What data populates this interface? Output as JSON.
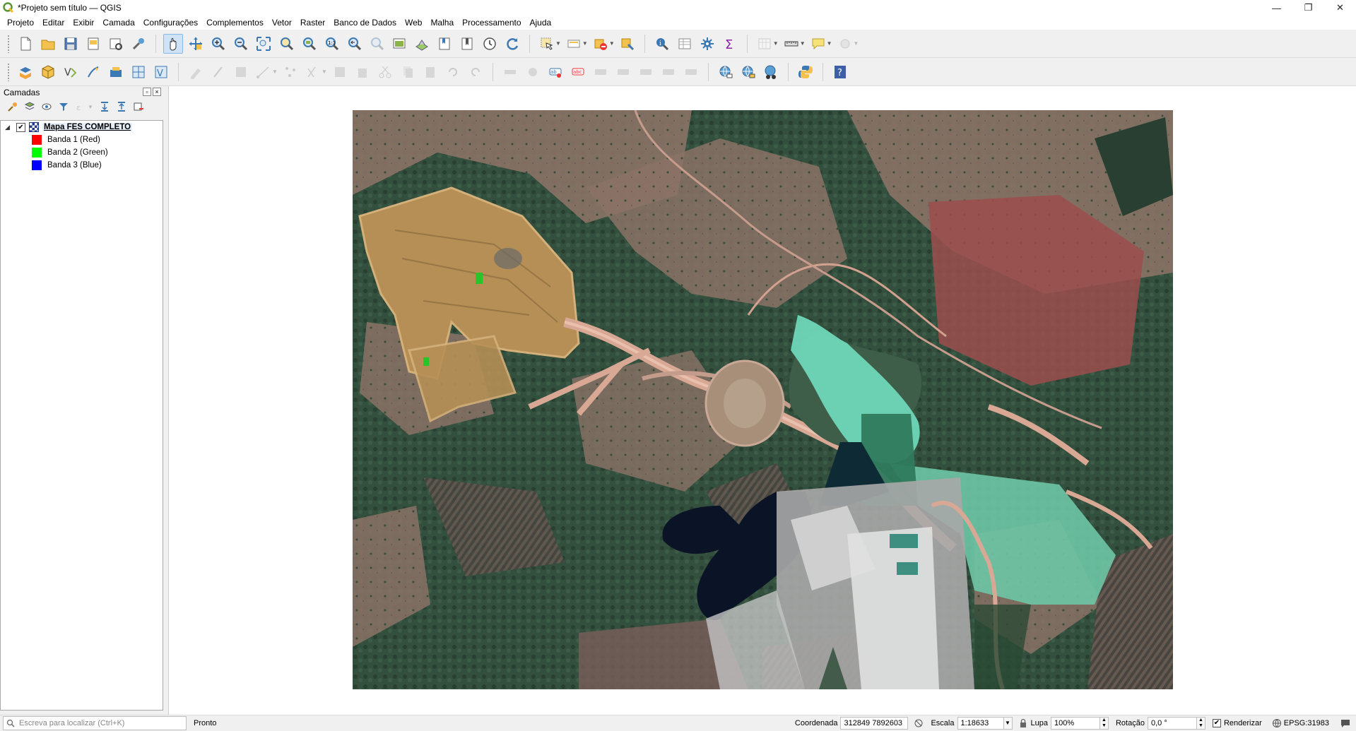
{
  "window": {
    "title": "*Projeto sem título — QGIS",
    "controls": {
      "minimize": "—",
      "maximize": "❐",
      "close": "✕"
    }
  },
  "menu": [
    "Projeto",
    "Editar",
    "Exibir",
    "Camada",
    "Configurações",
    "Complementos",
    "Vetor",
    "Raster",
    "Banco de Dados",
    "Web",
    "Malha",
    "Processamento",
    "Ajuda"
  ],
  "toolbars": {
    "primary_icons": [
      "new-project-icon",
      "open-project-icon",
      "save-project-icon",
      "new-print-layout-icon",
      "layout-manager-icon",
      "style-manager-icon",
      "pan-map-icon",
      "pan-to-selection-icon",
      "zoom-in-icon",
      "zoom-out-icon",
      "zoom-full-icon",
      "zoom-to-selection-icon",
      "zoom-to-layer-icon",
      "zoom-native-icon",
      "zoom-last-icon",
      "zoom-next-icon",
      "new-map-view-icon",
      "new-3d-view-icon",
      "spatial-bookmark-icon",
      "show-bookmarks-icon",
      "temporal-controller-icon",
      "refresh-icon",
      "select-features-icon",
      "select-by-value-icon",
      "deselect-icon",
      "select-by-location-icon",
      "identify-icon",
      "attribute-table-icon",
      "toolbox-icon",
      "statistics-icon",
      "open-field-calculator-icon",
      "measure-icon",
      "map-tips-icon",
      "annotation-icon"
    ],
    "secondary_icons": [
      "add-data-source-icon",
      "new-geopackage-layer-icon",
      "new-shapefile-layer-icon",
      "new-spatialite-layer-icon",
      "new-temporary-layer-icon",
      "new-virtual-layer-icon",
      "vector-tools-icon",
      "current-edits-icon",
      "toggle-editing-icon",
      "save-edits-icon",
      "digitize-icon",
      "vertex-tool-icon",
      "modify-attributes-icon",
      "delete-selected-icon",
      "cut-features-icon",
      "copy-features-icon",
      "paste-features-icon",
      "undo-icon",
      "redo-icon",
      "label-toolbar-icon",
      "diagram-icon",
      "highlight-pinned-labels-icon",
      "pin-labels-icon",
      "show-hide-labels-icon",
      "move-label-icon",
      "rotate-label-icon",
      "change-label-icon",
      "wms-icon",
      "wfs-icon",
      "metasearch-icon",
      "python-console-icon",
      "help-icon"
    ]
  },
  "layers_panel": {
    "title": "Camadas",
    "layer": {
      "name": "Mapa FES COMPLETO",
      "checked": true,
      "bands": [
        {
          "label": "Banda 1 (Red)",
          "color": "#ff0000"
        },
        {
          "label": "Banda 2 (Green)",
          "color": "#00ff00"
        },
        {
          "label": "Banda 3 (Blue)",
          "color": "#0000ff"
        }
      ]
    }
  },
  "statusbar": {
    "locator_placeholder": "Escreva para localizar (Ctrl+K)",
    "message": "Pronto",
    "coordinate_label": "Coordenada",
    "coordinate_value": "312849 7892603",
    "scale_label": "Escala",
    "scale_value": "1:18633",
    "magnifier_label": "Lupa",
    "magnifier_value": "100%",
    "rotation_label": "Rotação",
    "rotation_value": "0,0 °",
    "render_label": "Renderizar",
    "render_checked": true,
    "crs": "EPSG:31983"
  },
  "colors": {
    "accent": "#3c78b4",
    "map_forest": "#2f4d3b",
    "map_pasture": "#8c7468",
    "map_water_light": "#6fd6b8",
    "map_water_dark": "#101a2e",
    "map_mine": "#b7945a"
  }
}
